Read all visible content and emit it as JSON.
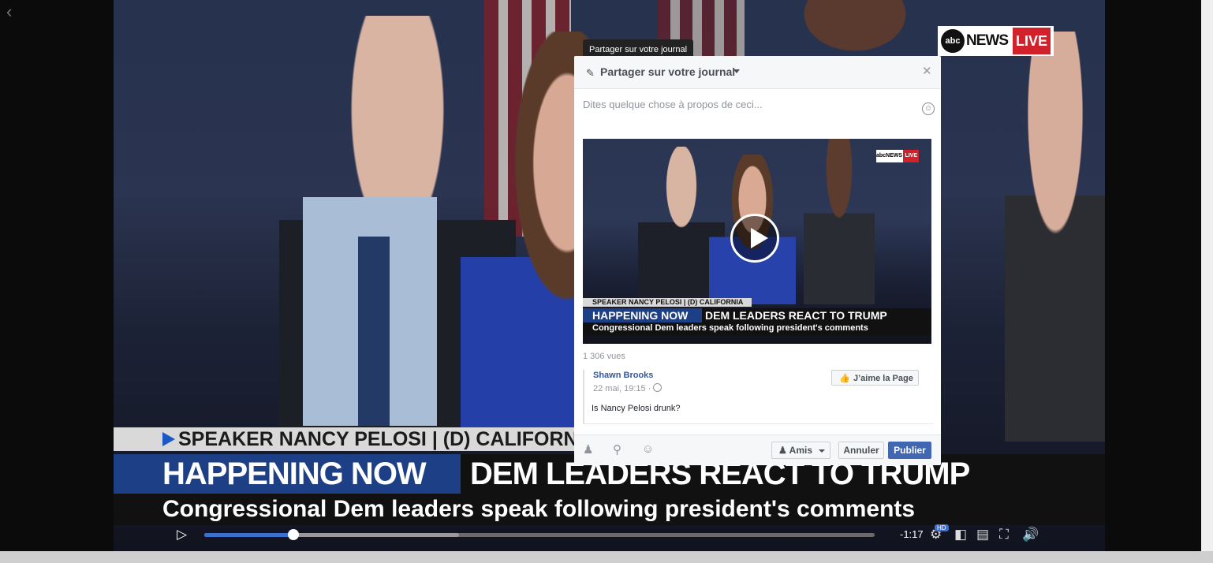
{
  "video": {
    "logo": {
      "brand": "abcNEWS",
      "abc": "abc",
      "news": "NEWS",
      "live": "LIVE"
    },
    "speaker": "SPEAKER NANCY PELOSI | (D) CALIFORNIA",
    "headline_label": "HAPPENING NOW",
    "headline": "DEM LEADERS REACT TO TRUMP",
    "subline": "Congressional Dem leaders speak following president's comments",
    "controls": {
      "time_remaining": "-1:17",
      "hd_badge": "HD",
      "progress_fraction": 0.133,
      "buffered_fraction": 0.38
    }
  },
  "tooltip": "Partager sur votre journal",
  "dialog": {
    "header_title": "Partager sur votre journal",
    "composer_placeholder": "Dites quelque chose à propos de ceci...",
    "thumbnail": {
      "speaker": "SPEAKER NANCY PELOSI | (D) CALIFORNIA",
      "headline_label": "HAPPENING NOW",
      "headline": "DEM LEADERS REACT TO TRUMP",
      "subline": "Congressional Dem leaders speak following president's comments",
      "logo_news": "abcNEWS",
      "logo_live": "LIVE"
    },
    "views": "1 306 vues",
    "post": {
      "author": "Shawn Brooks",
      "date": "22 mai, 19:15 ·",
      "text": "Is Nancy Pelosi drunk?",
      "like_button": "J’aime la Page"
    },
    "footer": {
      "audience": "Amis",
      "cancel": "Annuler",
      "publish": "Publier"
    }
  },
  "colors": {
    "facebook_blue": "#4267b2",
    "link_blue": "#365899",
    "live_red": "#d1222b",
    "progress_blue": "#3b6fd0"
  },
  "icons": [
    "chevron-left-icon",
    "play-icon",
    "settings-icon",
    "hd-badge",
    "picture-in-picture-icon",
    "cast-icon",
    "fullscreen-icon",
    "volume-icon",
    "pencil-icon",
    "close-icon",
    "emoji-icon",
    "globe-icon",
    "thumbs-up-icon",
    "tag-friends-icon",
    "location-icon",
    "feeling-icon",
    "friends-icon",
    "caret-down-icon"
  ]
}
